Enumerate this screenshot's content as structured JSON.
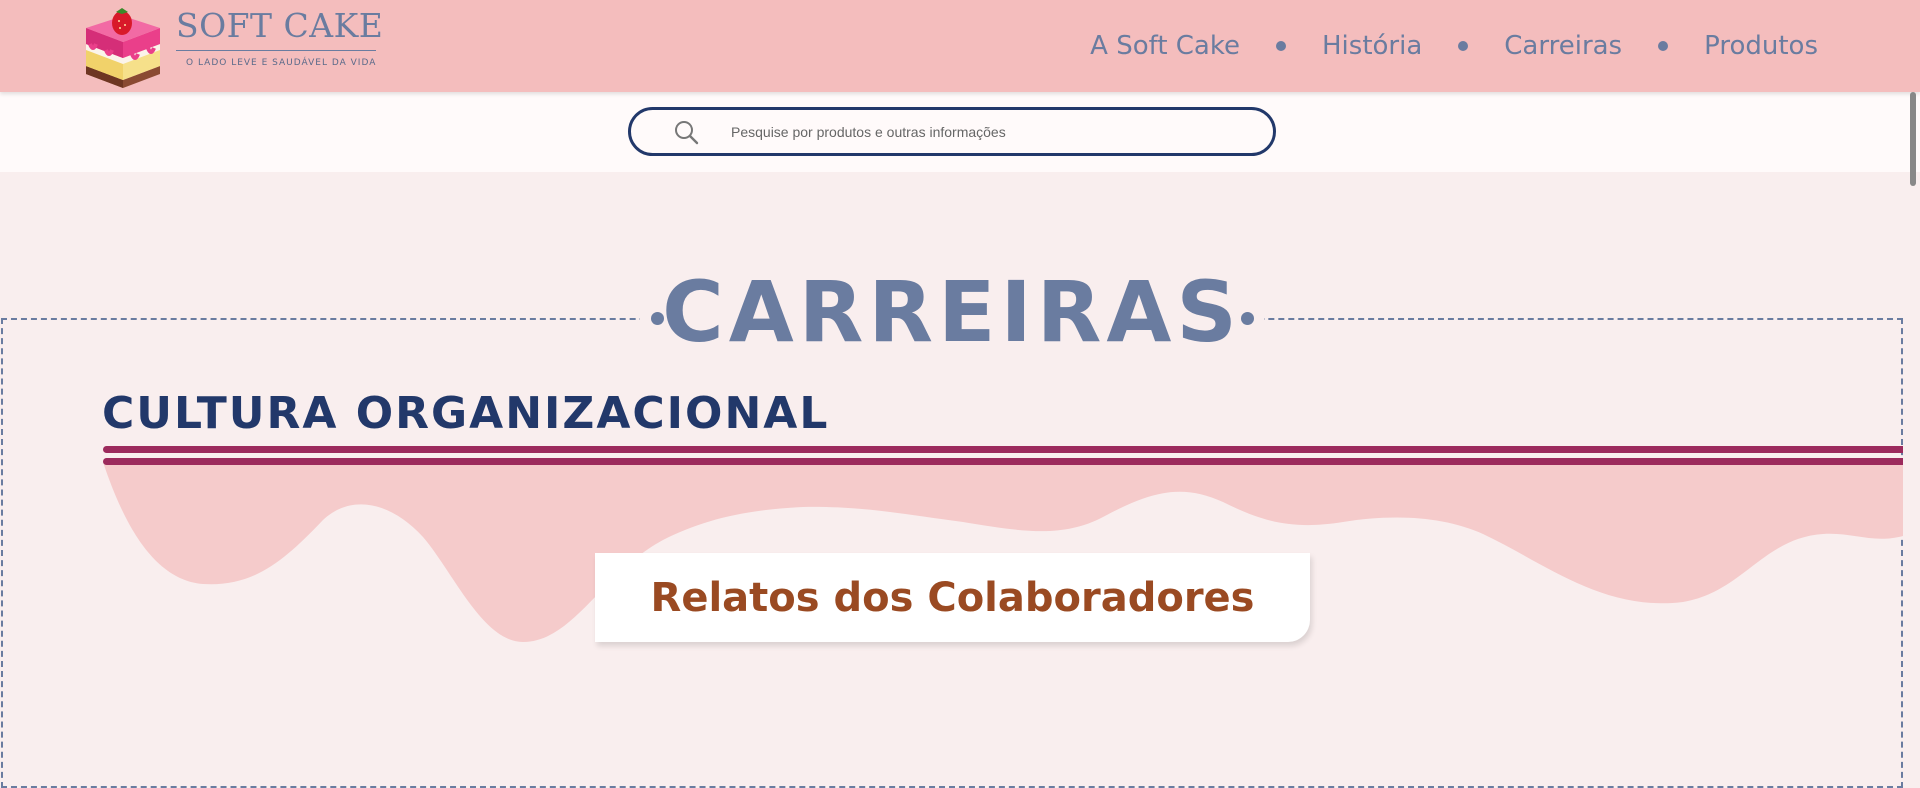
{
  "brand": {
    "name": "SOFT CAKE",
    "tagline": "O LADO LEVE E SAUDÁVEL DA VIDA"
  },
  "nav": {
    "items": [
      {
        "label": "A Soft Cake"
      },
      {
        "label": "História"
      },
      {
        "label": "Carreiras"
      },
      {
        "label": "Produtos"
      }
    ]
  },
  "search": {
    "placeholder": "Pesquise por produtos e outras informações",
    "icon": "search-icon"
  },
  "page": {
    "title": "CARREIRAS",
    "section_heading": "CULTURA ORGANIZACIONAL",
    "card_title": "Relatos dos Colaboradores"
  },
  "colors": {
    "header_bg": "#f4bdbd",
    "page_bg": "#f9eeee",
    "title_blue": "#6a7ca0",
    "heading_navy": "#22386a",
    "stripe_magenta": "#9c2a5c",
    "wave_pink": "#f5cbcb",
    "card_text_brown": "#9a4a22"
  }
}
